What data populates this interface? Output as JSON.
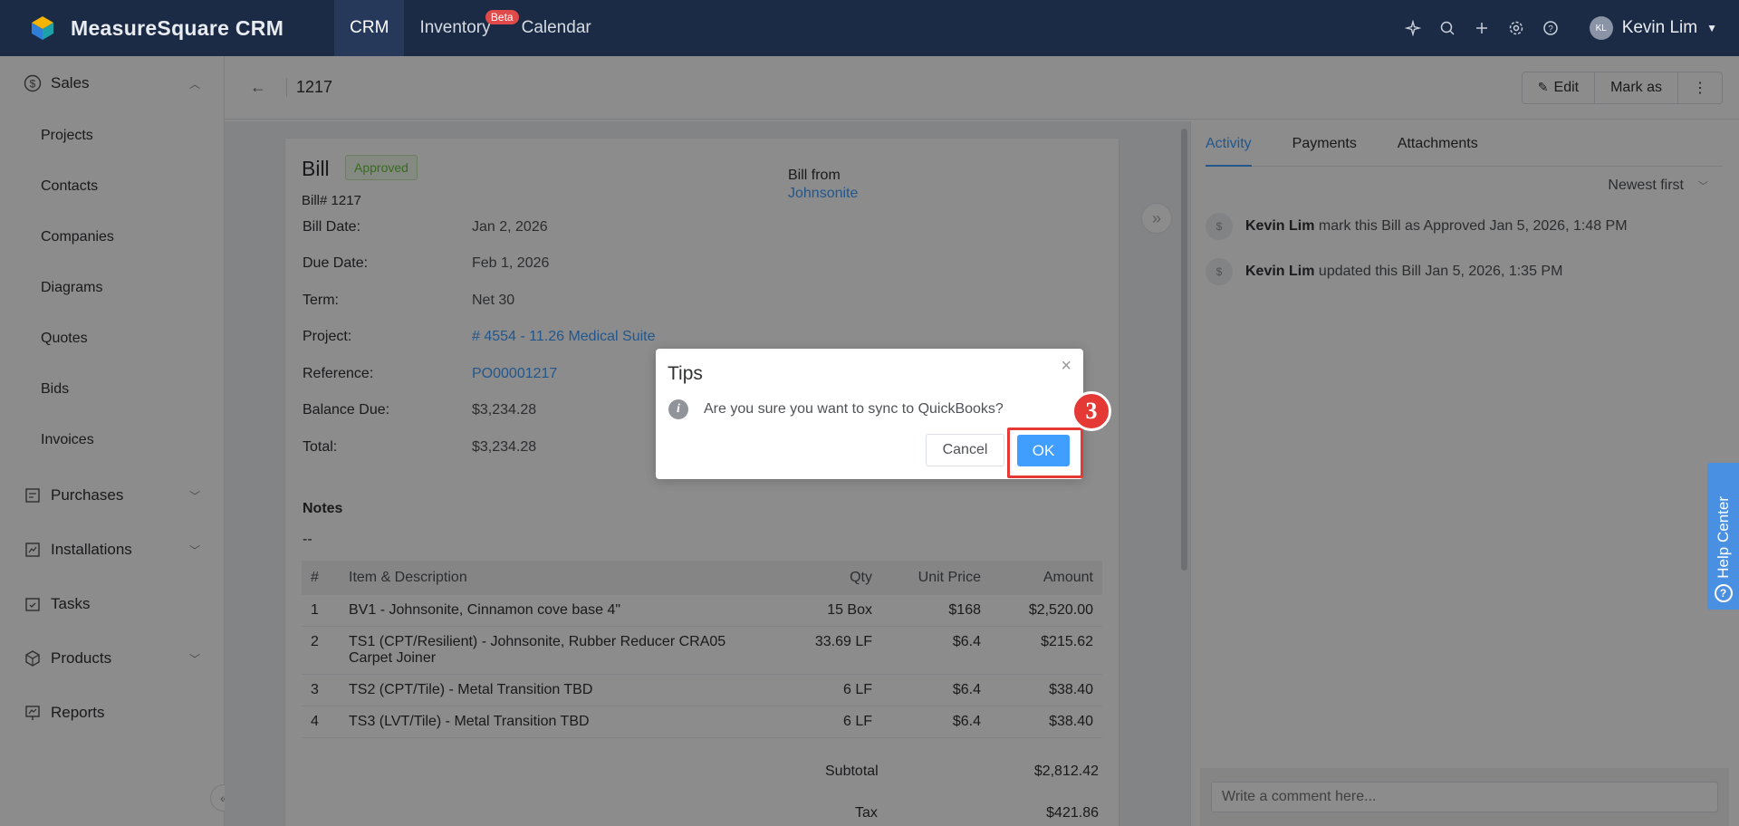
{
  "topbar": {
    "brand": "MeasureSquare CRM",
    "nav": [
      {
        "label": "CRM"
      },
      {
        "label": "Inventory",
        "badge": "Beta"
      },
      {
        "label": "Calendar"
      }
    ],
    "icons": [
      "sparkle-icon",
      "search-icon",
      "plus-icon",
      "gear-icon",
      "help-icon"
    ],
    "user": {
      "initials": "KL",
      "name": "Kevin Lim"
    }
  },
  "sidebar": {
    "sales": "Sales",
    "sales_items": [
      "Projects",
      "Contacts",
      "Companies",
      "Diagrams",
      "Quotes",
      "Bids",
      "Invoices"
    ],
    "purchases": "Purchases",
    "installations": "Installations",
    "tasks": "Tasks",
    "products": "Products",
    "reports": "Reports"
  },
  "header": {
    "id": "1217",
    "edit": "Edit",
    "mark_as": "Mark as"
  },
  "bill": {
    "title": "Bill",
    "status": "Approved",
    "number": "Bill# 1217",
    "bill_from_label": "Bill from",
    "bill_from": "Johnsonite",
    "fields": [
      {
        "label": "Bill Date:",
        "value": "Jan 2, 2026"
      },
      {
        "label": "Due Date:",
        "value": "Feb 1, 2026"
      },
      {
        "label": "Term:",
        "value": "Net 30"
      },
      {
        "label": "Project:",
        "value": "# 4554 - 11.26 Medical Suite"
      },
      {
        "label": "Reference:",
        "value": "PO00001217"
      },
      {
        "label": "Balance Due:",
        "value": "$3,234.28"
      },
      {
        "label": "Total:",
        "value": "$3,234.28"
      }
    ],
    "notes_label": "Notes",
    "notes": "--",
    "columns": [
      "#",
      "Item & Description",
      "Qty",
      "Unit Price",
      "Amount"
    ],
    "rows": [
      {
        "n": "1",
        "desc": "BV1 - Johnsonite, Cinnamon cove base 4\"",
        "qty": "15 Box",
        "price": "$168",
        "amount": "$2,520.00"
      },
      {
        "n": "2",
        "desc": "TS1 (CPT/Resilient) - Johnsonite, Rubber Reducer CRA05 Carpet Joiner",
        "qty": "33.69 LF",
        "price": "$6.4",
        "amount": "$215.62"
      },
      {
        "n": "3",
        "desc": "TS2 (CPT/Tile) - Metal Transition TBD",
        "qty": "6 LF",
        "price": "$6.4",
        "amount": "$38.40"
      },
      {
        "n": "4",
        "desc": "TS3 (LVT/Tile) - Metal Transition TBD",
        "qty": "6 LF",
        "price": "$6.4",
        "amount": "$38.40"
      }
    ],
    "subtotal_label": "Subtotal",
    "subtotal": "$2,812.42",
    "tax_label": "Tax",
    "tax": "$421.86"
  },
  "panel": {
    "tabs": [
      "Activity",
      "Payments",
      "Attachments"
    ],
    "sort": "Newest first",
    "activities": [
      {
        "user": "Kevin Lim",
        "text": " mark this Bill  as Approved Jan 5, 2026, 1:48 PM"
      },
      {
        "user": "Kevin Lim",
        "text": " updated this Bill Jan 5, 2026, 1:35 PM"
      }
    ],
    "comment_placeholder": "Write a comment here..."
  },
  "dialog": {
    "title": "Tips",
    "message": "Are you sure you want to sync to QuickBooks?",
    "cancel": "Cancel",
    "ok": "OK"
  },
  "annotation": {
    "step": "3"
  },
  "help_center": "Help Center"
}
